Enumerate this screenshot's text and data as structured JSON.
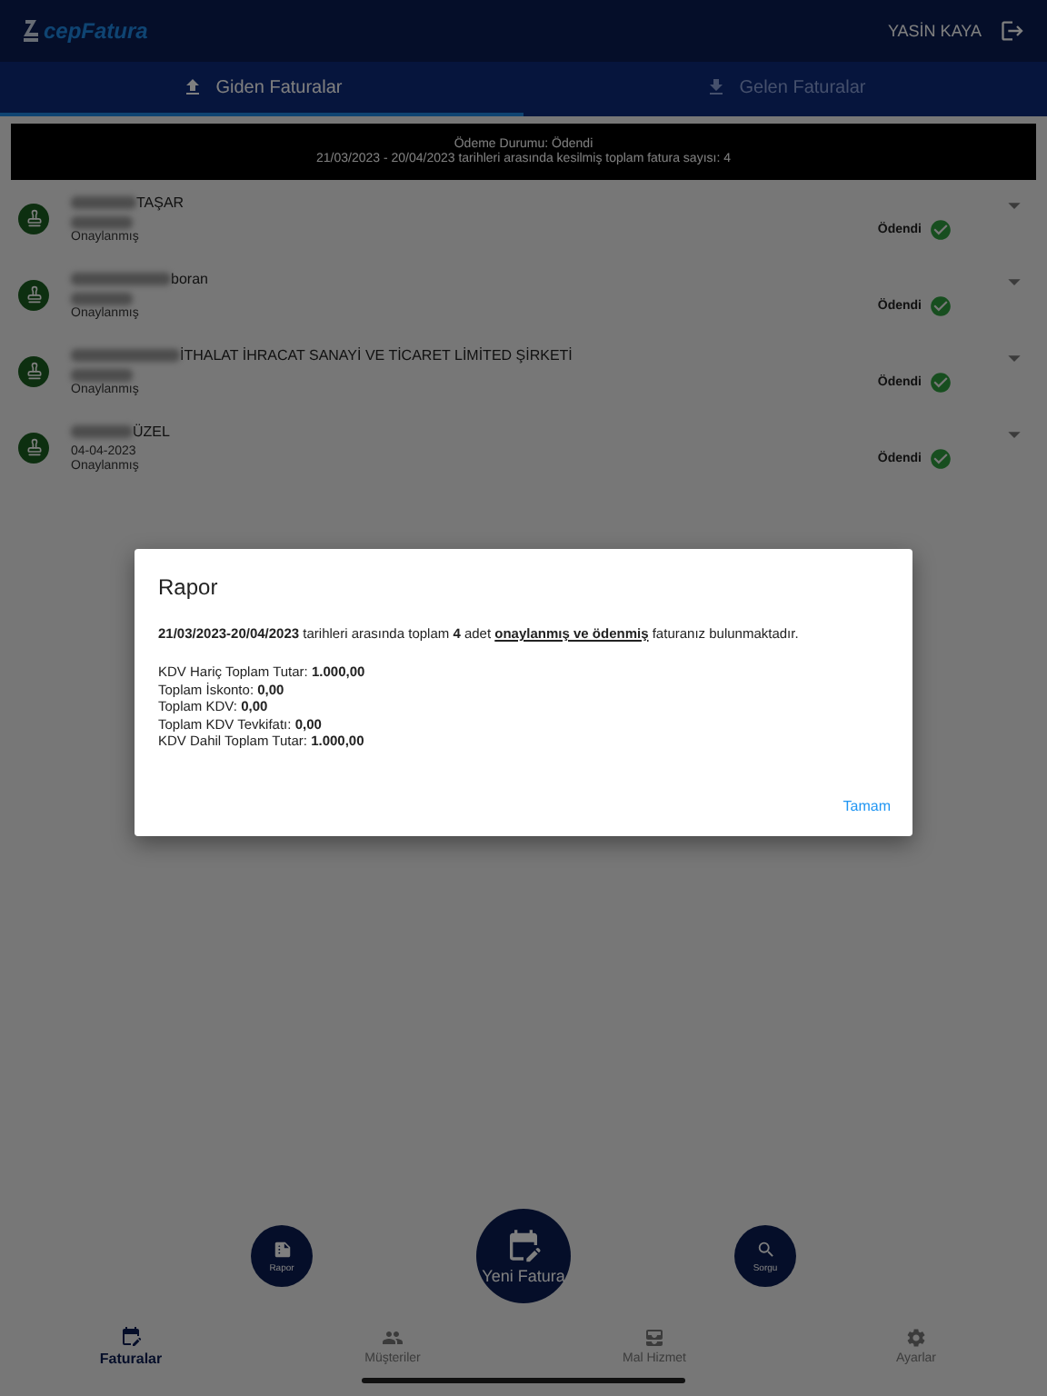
{
  "header": {
    "logo": "cepFatura",
    "user": "YASİN KAYA"
  },
  "tabs": [
    {
      "label": "Giden Faturalar",
      "kind": "upload",
      "selected": true
    },
    {
      "label": "Gelen Faturalar",
      "kind": "download",
      "selected": false
    }
  ],
  "banner": {
    "lines": [
      "Ödeme Durumu: Ödendi",
      "21/03/2023 - 20/04/2023 tarihleri arasında kesilmiş toplam fatura sayısı: 4"
    ]
  },
  "invoices": [
    {
      "name": "TAŞAR",
      "name_redacted": true,
      "date_redacted": true,
      "status": "Onaylanmış",
      "payment": "Ödendi",
      "paid": true
    },
    {
      "name": "boran",
      "name_redacted": true,
      "date_redacted": true,
      "status": "Onaylanmış",
      "payment": "Ödendi",
      "paid": true
    },
    {
      "name": "İTHALAT İHRACAT SANAYİ VE TİCARET LİMİTED ŞİRKETİ",
      "name_redacted": true,
      "date_redacted": true,
      "status": "Onaylanmış",
      "payment": "Ödendi",
      "paid": true
    },
    {
      "name": "ÜZEL",
      "name_redacted": true,
      "date": "04-04-2023",
      "status": "Onaylanmış",
      "payment": "Ödendi",
      "paid": true
    }
  ],
  "dialog": {
    "title": "Rapor",
    "message": [
      {
        "text": "21/03/2023-20/04/2023",
        "bold": true,
        "underline": false
      },
      {
        "text": " tarihleri arasında toplam ",
        "bold": false,
        "underline": false
      },
      {
        "text": "4",
        "bold": true,
        "underline": false
      },
      {
        "text": " adet ",
        "bold": false,
        "underline": false
      },
      {
        "text": "onaylanmış ve ödenmiş",
        "bold": true,
        "underline": true
      },
      {
        "text": " faturanız bulunmaktadır.",
        "bold": false,
        "underline": false
      }
    ],
    "totals": [
      {
        "label": "KDV Hariç Toplam Tutar: ",
        "value": "1.000,00"
      },
      {
        "label": "Toplam İskonto: ",
        "value": "0,00"
      },
      {
        "label": "Toplam KDV: ",
        "value": "0,00"
      },
      {
        "label": "Toplam KDV Tevkifatı: ",
        "value": "0,00"
      },
      {
        "label": "KDV Dahil Toplam Tutar: ",
        "value": "1.000,00"
      }
    ],
    "button": "Tamam"
  },
  "fabs": [
    {
      "label": "Rapor",
      "kind": "report"
    },
    {
      "label": "Yeni Fatura",
      "kind": "new"
    },
    {
      "label": "Sorgu",
      "kind": "search"
    }
  ],
  "nav": [
    {
      "label": "Faturalar",
      "kind": "invoices",
      "selected": true
    },
    {
      "label": "Müşteriler",
      "kind": "customers",
      "selected": false
    },
    {
      "label": "Mal Hizmet",
      "kind": "goods",
      "selected": false
    },
    {
      "label": "Ayarlar",
      "kind": "settings",
      "selected": false
    }
  ]
}
